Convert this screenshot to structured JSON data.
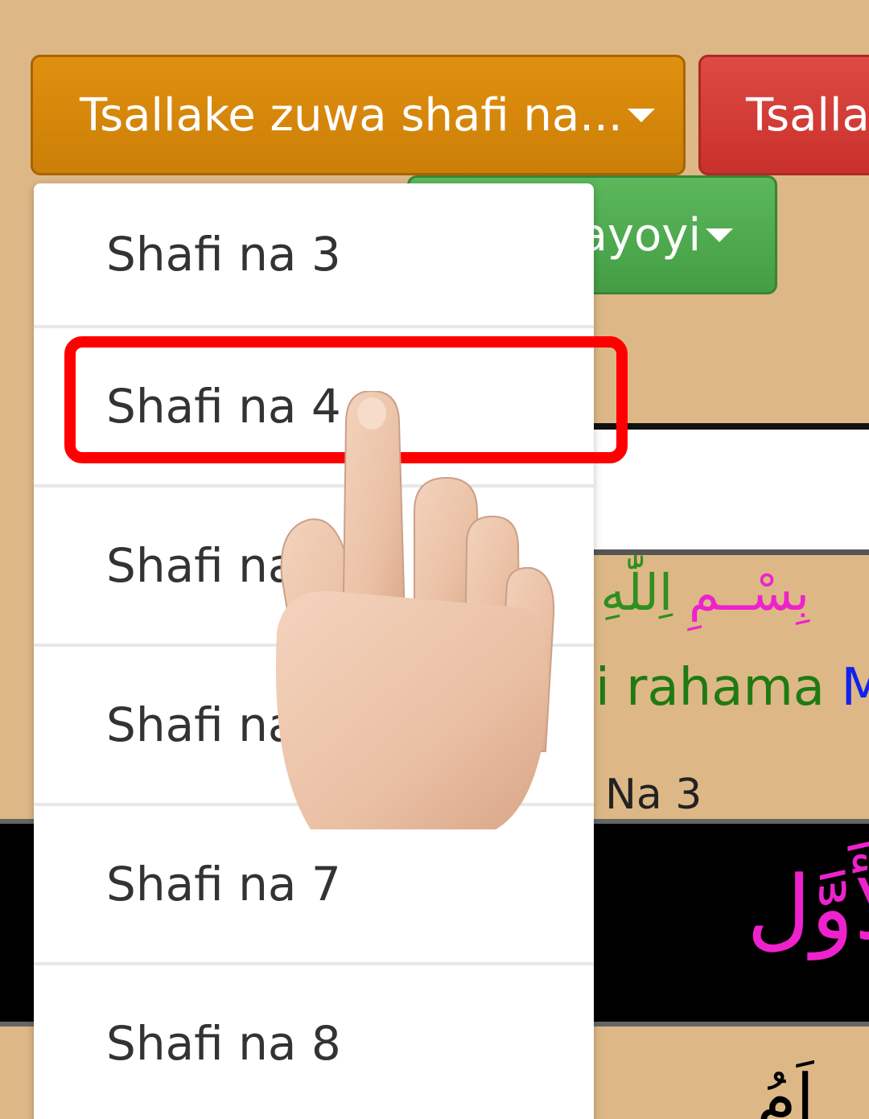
{
  "toolbar": {
    "skip_page_label": "Tsallake zuwa shafi na...",
    "skip_red_label": "Tsallake zuwa",
    "green_label": "ayoyi"
  },
  "dropdown": {
    "items": [
      {
        "label": "Shafi na 3"
      },
      {
        "label": "Shafi na 4"
      },
      {
        "label": "Shafi na"
      },
      {
        "label": "Shafi na"
      },
      {
        "label": "Shafi na 7"
      },
      {
        "label": "Shafi na 8"
      }
    ]
  },
  "content": {
    "bismillah_magenta": "بِسْــمِ",
    "bismillah_green": "اِللّٰهِ الرَّ",
    "translation_green": "i rahama",
    "translation_blue": "M",
    "page_label": "Na 3",
    "heading_arabic": "لأَوَّل",
    "verse_fragment": "اَمُ"
  },
  "colors": {
    "background": "#ddb886",
    "orange_button": "#d4860b",
    "red_button": "#d9534f",
    "green_button": "#5cb85c",
    "highlight": "#ff0000",
    "arabic_magenta": "#ee22cc"
  }
}
